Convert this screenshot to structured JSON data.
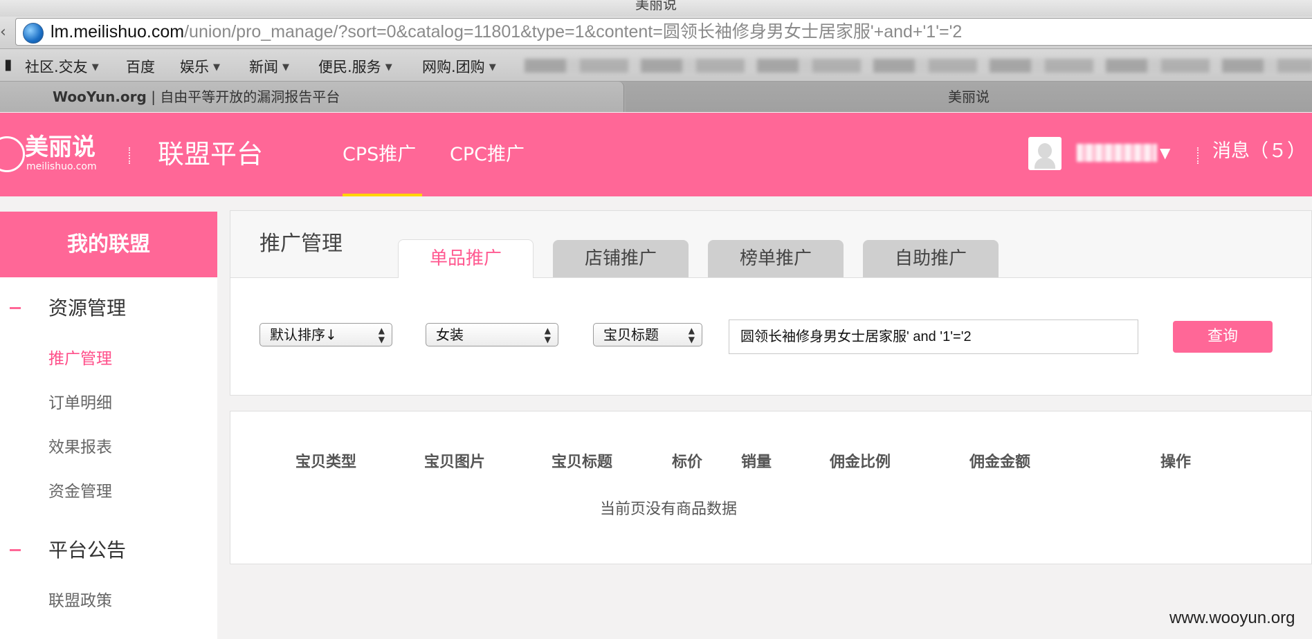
{
  "window": {
    "title": "美丽说"
  },
  "url": {
    "host": "lm.meilishuo.com",
    "path": "/union/pro_manage/?sort=0&catalog=11801&type=1&content=圆领长袖修身男女士居家服'+and+'1'='2"
  },
  "bookmarks": [
    {
      "label": "社区.交友",
      "has_menu": true
    },
    {
      "label": "百度",
      "has_menu": false
    },
    {
      "label": "娱乐",
      "has_menu": true
    },
    {
      "label": "新闻",
      "has_menu": true
    },
    {
      "label": "便民.服务",
      "has_menu": true
    },
    {
      "label": "网购.团购",
      "has_menu": true
    }
  ],
  "tabs": {
    "active_site": "WooYun.org",
    "active_desc": "自由平等开放的漏洞报告平台",
    "inactive": "美丽说"
  },
  "header": {
    "logo_cn": "美丽说",
    "logo_en": "meilishuo.com",
    "brand": "联盟平台",
    "nav": [
      {
        "label": "CPS推广",
        "active": true
      },
      {
        "label": "CPC推广",
        "active": false
      }
    ],
    "messages": "消息（５）",
    "accent": "#ff6797"
  },
  "sidebar": {
    "title": "我的联盟",
    "groups": [
      {
        "label": "资源管理",
        "items": [
          {
            "label": "推广管理",
            "active": true
          },
          {
            "label": "订单明细",
            "active": false
          },
          {
            "label": "效果报表",
            "active": false
          },
          {
            "label": "资金管理",
            "active": false
          }
        ]
      },
      {
        "label": "平台公告",
        "items": [
          {
            "label": "联盟政策",
            "active": false
          }
        ]
      }
    ]
  },
  "panel": {
    "title": "推广管理",
    "tabs": [
      {
        "label": "单品推广",
        "active": true
      },
      {
        "label": "店铺推广",
        "active": false
      },
      {
        "label": "榜单推广",
        "active": false
      },
      {
        "label": "自助推广",
        "active": false
      }
    ],
    "filters": {
      "sort": "默认排序↓",
      "category": "女装",
      "field": "宝贝标题",
      "search_value": "圆领长袖修身男女士居家服' and '1'='2",
      "query_label": "查询"
    }
  },
  "table": {
    "columns": [
      "宝贝类型",
      "宝贝图片",
      "宝贝标题",
      "标价",
      "销量",
      "佣金比例",
      "佣金金额",
      "操作"
    ],
    "empty_text": "当前页没有商品数据"
  },
  "watermark": "www.wooyun.org"
}
